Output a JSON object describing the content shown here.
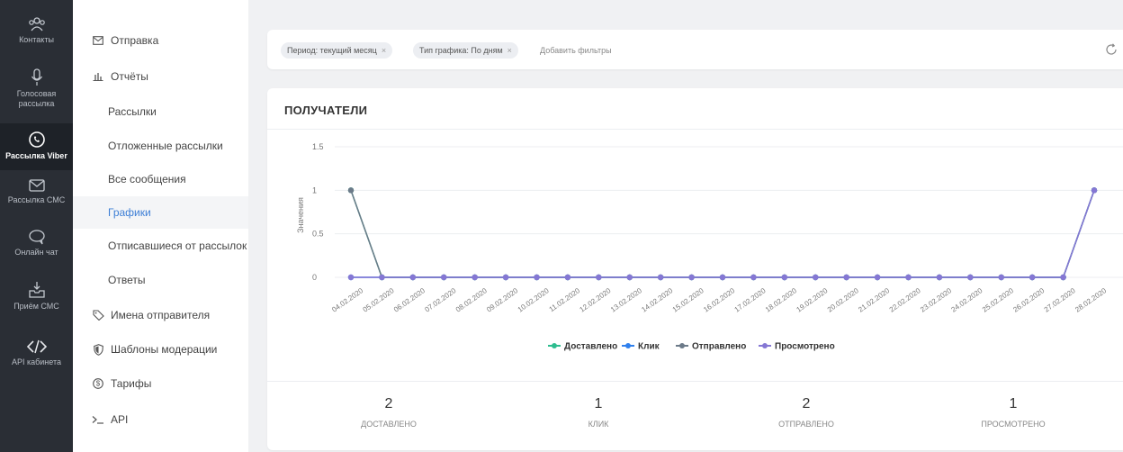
{
  "rail": [
    {
      "id": "contacts",
      "label": "Контакты",
      "icon": "people-icon"
    },
    {
      "id": "voice",
      "label": "Голосовая рассылка",
      "icon": "microphone-icon"
    },
    {
      "id": "viber",
      "label": "Рассылка Viber",
      "icon": "viber-icon",
      "active": true
    },
    {
      "id": "sms",
      "label": "Рассылка СМС",
      "icon": "envelope-icon"
    },
    {
      "id": "chat",
      "label": "Онлайн чат",
      "icon": "chat-icon"
    },
    {
      "id": "receive",
      "label": "Приём СМС",
      "icon": "inbox-icon"
    },
    {
      "id": "api",
      "label": "API кабинета",
      "icon": "code-icon"
    }
  ],
  "menu": [
    {
      "label": "Отправка",
      "icon": "envelope-icon",
      "type": "top"
    },
    {
      "label": "Отчёты",
      "icon": "bar-chart-icon",
      "type": "top"
    },
    {
      "label": "Рассылки",
      "type": "sub"
    },
    {
      "label": "Отложенные рассылки",
      "type": "sub"
    },
    {
      "label": "Все сообщения",
      "type": "sub"
    },
    {
      "label": "Графики",
      "type": "sub",
      "active": true
    },
    {
      "label": "Отписавшиеся от рассылок",
      "type": "sub"
    },
    {
      "label": "Ответы",
      "type": "sub"
    },
    {
      "label": "Имена отправителя",
      "icon": "tag-icon",
      "type": "top"
    },
    {
      "label": "Шаблоны модерации",
      "icon": "shield-icon",
      "type": "top"
    },
    {
      "label": "Тарифы",
      "icon": "dollar-icon",
      "type": "top"
    },
    {
      "label": "API",
      "icon": "terminal-icon",
      "type": "top"
    }
  ],
  "filters": {
    "chips": [
      {
        "label": "Период: текущий месяц",
        "remove": "×"
      },
      {
        "label": "Тип графика: По дням",
        "remove": "×"
      }
    ],
    "add_label": "Добавить фильтры"
  },
  "card": {
    "title": "ПОЛУЧАТЕЛИ"
  },
  "chart_data": {
    "type": "line",
    "ylabel": "Значения",
    "ylim": [
      0,
      1.5
    ],
    "yticks": [
      "0",
      "0.5",
      "1",
      "1.5"
    ],
    "categories": [
      "04.02.2020",
      "05.02.2020",
      "06.02.2020",
      "07.02.2020",
      "08.02.2020",
      "09.02.2020",
      "10.02.2020",
      "11.02.2020",
      "12.02.2020",
      "13.02.2020",
      "14.02.2020",
      "15.02.2020",
      "16.02.2020",
      "17.02.2020",
      "18.02.2020",
      "19.02.2020",
      "20.02.2020",
      "21.02.2020",
      "22.02.2020",
      "23.02.2020",
      "24.02.2020",
      "25.02.2020",
      "26.02.2020",
      "27.02.2020",
      "28.02.2020"
    ],
    "series": [
      {
        "name": "Доставлено",
        "color": "#2ebd8f",
        "values": [
          1,
          0,
          0,
          0,
          0,
          0,
          0,
          0,
          0,
          0,
          0,
          0,
          0,
          0,
          0,
          0,
          0,
          0,
          0,
          0,
          0,
          0,
          0,
          0,
          1
        ]
      },
      {
        "name": "Клик",
        "color": "#2f80ed",
        "values": [
          0,
          0,
          0,
          0,
          0,
          0,
          0,
          0,
          0,
          0,
          0,
          0,
          0,
          0,
          0,
          0,
          0,
          0,
          0,
          0,
          0,
          0,
          0,
          0,
          1
        ]
      },
      {
        "name": "Отправлено",
        "color": "#6c7a89",
        "values": [
          1,
          0,
          0,
          0,
          0,
          0,
          0,
          0,
          0,
          0,
          0,
          0,
          0,
          0,
          0,
          0,
          0,
          0,
          0,
          0,
          0,
          0,
          0,
          0,
          1
        ]
      },
      {
        "name": "Просмотрено",
        "color": "#8577d4",
        "values": [
          0,
          0,
          0,
          0,
          0,
          0,
          0,
          0,
          0,
          0,
          0,
          0,
          0,
          0,
          0,
          0,
          0,
          0,
          0,
          0,
          0,
          0,
          0,
          0,
          1
        ]
      }
    ],
    "legend": "bottom",
    "grid": true
  },
  "stats": [
    {
      "value": "2",
      "label": "ДОСТАВЛЕНО"
    },
    {
      "value": "1",
      "label": "КЛИК"
    },
    {
      "value": "2",
      "label": "ОТПРАВЛЕНО"
    },
    {
      "value": "1",
      "label": "ПРОСМОТРЕНО"
    }
  ]
}
